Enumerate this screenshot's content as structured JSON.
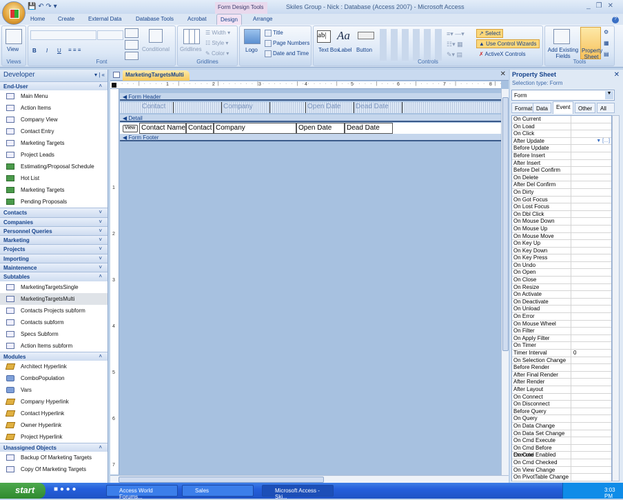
{
  "window": {
    "title": "Skiles Group - Nick : Database (Access 2007) - Microsoft Access",
    "context_tab": "Form Design Tools"
  },
  "tabs": [
    "Home",
    "Create",
    "External Data",
    "Database Tools",
    "Acrobat",
    "Design",
    "Arrange"
  ],
  "active_tab": "Design",
  "ribbon": {
    "views": {
      "label": "Views",
      "view": "View"
    },
    "font": {
      "label": "Font",
      "bold": "B",
      "italic": "I",
      "underline": "U",
      "conditional": "Conditional"
    },
    "gridlines": {
      "label": "Gridlines",
      "gridlines": "Gridlines",
      "width": "Width",
      "style": "Style",
      "color": "Color"
    },
    "header": {
      "logo": "Logo",
      "title": "Title",
      "page_numbers": "Page Numbers",
      "date_time": "Date and Time"
    },
    "controls": {
      "label": "Controls",
      "text_box": "Text Box",
      "label_btn": "Label",
      "button": "Button",
      "select": "Select",
      "wizards": "Use Control Wizards",
      "activex": "ActiveX Controls"
    },
    "tools": {
      "label": "Tools",
      "add_fields": "Add Existing Fields",
      "property_sheet": "Property Sheet"
    }
  },
  "nav": {
    "title": "Developer",
    "groups": [
      {
        "name": "End-User",
        "expanded": true,
        "items": [
          {
            "label": "Main Menu",
            "type": "form"
          },
          {
            "label": "Action Items",
            "type": "form"
          },
          {
            "label": "Company View",
            "type": "form"
          },
          {
            "label": "Contact Entry",
            "type": "form"
          },
          {
            "label": "Marketing Targets",
            "type": "form"
          },
          {
            "label": "Project Leads",
            "type": "form"
          },
          {
            "label": "Estimating/Proposal Schedule",
            "type": "report"
          },
          {
            "label": "Hot List",
            "type": "report"
          },
          {
            "label": "Marketing Targets",
            "type": "report"
          },
          {
            "label": "Pending Proposals",
            "type": "report"
          }
        ]
      },
      {
        "name": "Contacts",
        "expanded": false,
        "items": []
      },
      {
        "name": "Companies",
        "expanded": false,
        "items": []
      },
      {
        "name": "Personnel Queries",
        "expanded": false,
        "items": []
      },
      {
        "name": "Marketing",
        "expanded": false,
        "items": []
      },
      {
        "name": "Projects",
        "expanded": false,
        "items": []
      },
      {
        "name": "Importing",
        "expanded": false,
        "items": []
      },
      {
        "name": "Maintenence",
        "expanded": false,
        "items": []
      },
      {
        "name": "Subtables",
        "expanded": true,
        "items": [
          {
            "label": "MarketingTargetsSingle",
            "type": "form"
          },
          {
            "label": "MarketingTargetsMulti",
            "type": "form",
            "selected": true
          },
          {
            "label": "Contacts Projects subform",
            "type": "form"
          },
          {
            "label": "Contacts subform",
            "type": "form"
          },
          {
            "label": "Specs Subform",
            "type": "form"
          },
          {
            "label": "Action Items subform",
            "type": "form"
          }
        ]
      },
      {
        "name": "Modules",
        "expanded": true,
        "items": [
          {
            "label": "Architect Hyperlink",
            "type": "module"
          },
          {
            "label": "ComboPopulation",
            "type": "macro"
          },
          {
            "label": "Vars",
            "type": "macro"
          },
          {
            "label": "Company Hyperlink",
            "type": "module"
          },
          {
            "label": "Contact Hyperlink",
            "type": "module"
          },
          {
            "label": "Owner Hyperlink",
            "type": "module"
          },
          {
            "label": "Project Hyperlink",
            "type": "module"
          }
        ]
      },
      {
        "name": "Unassigned Objects",
        "expanded": true,
        "items": [
          {
            "label": "Backup Of Marketing Targets",
            "type": "form"
          },
          {
            "label": "Copy Of Marketing Targets",
            "type": "form"
          }
        ]
      }
    ]
  },
  "document": {
    "tab": "MarketingTargetsMulti",
    "ruler": [
      "1",
      "2",
      "3",
      "4",
      "5",
      "6",
      "7",
      "8"
    ],
    "vruler": [
      "1",
      "2",
      "3",
      "4",
      "5",
      "6",
      "7"
    ],
    "sections": {
      "header": "Form Header",
      "detail": "Detail",
      "footer": "Form Footer"
    },
    "header_labels": [
      "Contact",
      "Company",
      "Open Date",
      "Dead Date"
    ],
    "detail_controls": [
      "View",
      "Contact Name",
      "Contact I",
      "Company",
      "Open Date",
      "Dead Date"
    ]
  },
  "property_sheet": {
    "title": "Property Sheet",
    "selection_type": "Selection type:  Form",
    "selected_object": "Form",
    "tabs": [
      "Format",
      "Data",
      "Event",
      "Other",
      "All"
    ],
    "active_tab": "Event",
    "properties": [
      {
        "name": "On Current",
        "value": ""
      },
      {
        "name": "On Load",
        "value": ""
      },
      {
        "name": "On Click",
        "value": ""
      },
      {
        "name": "After Update",
        "value": "",
        "focused": true
      },
      {
        "name": "Before Update",
        "value": ""
      },
      {
        "name": "Before Insert",
        "value": ""
      },
      {
        "name": "After Insert",
        "value": ""
      },
      {
        "name": "Before Del Confirm",
        "value": ""
      },
      {
        "name": "On Delete",
        "value": ""
      },
      {
        "name": "After Del Confirm",
        "value": ""
      },
      {
        "name": "On Dirty",
        "value": ""
      },
      {
        "name": "On Got Focus",
        "value": ""
      },
      {
        "name": "On Lost Focus",
        "value": ""
      },
      {
        "name": "On Dbl Click",
        "value": ""
      },
      {
        "name": "On Mouse Down",
        "value": ""
      },
      {
        "name": "On Mouse Up",
        "value": ""
      },
      {
        "name": "On Mouse Move",
        "value": ""
      },
      {
        "name": "On Key Up",
        "value": ""
      },
      {
        "name": "On Key Down",
        "value": ""
      },
      {
        "name": "On Key Press",
        "value": ""
      },
      {
        "name": "On Undo",
        "value": ""
      },
      {
        "name": "On Open",
        "value": ""
      },
      {
        "name": "On Close",
        "value": ""
      },
      {
        "name": "On Resize",
        "value": ""
      },
      {
        "name": "On Activate",
        "value": ""
      },
      {
        "name": "On Deactivate",
        "value": ""
      },
      {
        "name": "On Unload",
        "value": ""
      },
      {
        "name": "On Error",
        "value": ""
      },
      {
        "name": "On Mouse Wheel",
        "value": ""
      },
      {
        "name": "On Filter",
        "value": ""
      },
      {
        "name": "On Apply Filter",
        "value": ""
      },
      {
        "name": "On Timer",
        "value": ""
      },
      {
        "name": "Timer Interval",
        "value": "0"
      },
      {
        "name": "On Selection Change",
        "value": ""
      },
      {
        "name": "Before Render",
        "value": ""
      },
      {
        "name": "After Final Render",
        "value": ""
      },
      {
        "name": "After Render",
        "value": ""
      },
      {
        "name": "After Layout",
        "value": ""
      },
      {
        "name": "On Connect",
        "value": ""
      },
      {
        "name": "On Disconnect",
        "value": ""
      },
      {
        "name": "Before Query",
        "value": ""
      },
      {
        "name": "On Query",
        "value": ""
      },
      {
        "name": "On Data Change",
        "value": ""
      },
      {
        "name": "On Data Set Change",
        "value": ""
      },
      {
        "name": "On Cmd Execute",
        "value": ""
      },
      {
        "name": "On Cmd Before Execute",
        "value": ""
      },
      {
        "name": "On Cmd Enabled",
        "value": ""
      },
      {
        "name": "On Cmd Checked",
        "value": ""
      },
      {
        "name": "On View Change",
        "value": ""
      },
      {
        "name": "On PivotTable Change",
        "value": ""
      }
    ]
  },
  "taskbar": {
    "start": "start",
    "buttons": [
      "Access World Forums...",
      "Sales",
      "Microsoft Access - Ski..."
    ],
    "active": "Microsoft Access - Ski...",
    "clock": "3:03 PM"
  }
}
